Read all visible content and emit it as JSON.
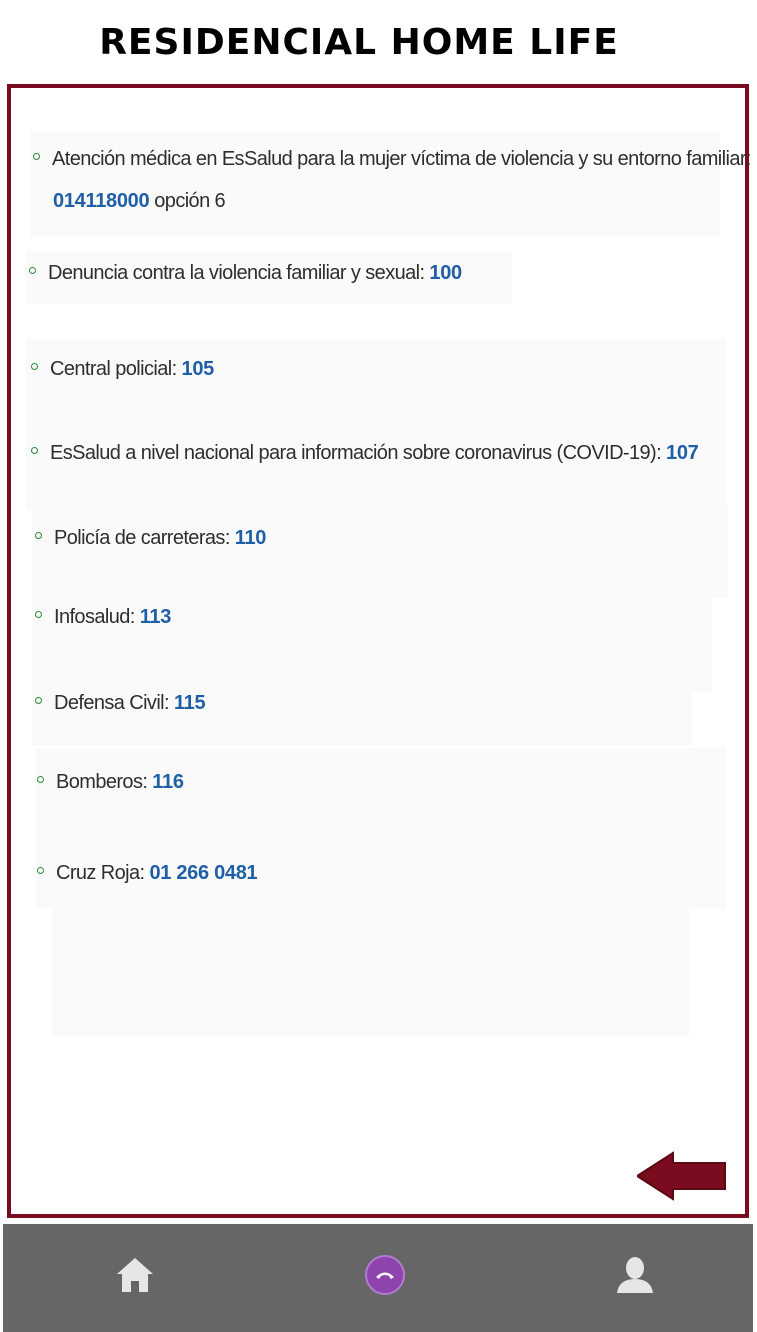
{
  "header": {
    "title": "RESIDENCIAL HOME LIFE"
  },
  "contacts": [
    {
      "label": "Atención médica en EsSalud para la mujer víctima de violencia y su entorno familiar:",
      "number": "014118000",
      "suffix": " opción 6"
    },
    {
      "label": "Denuncia contra la violencia familiar y sexual: ",
      "number": "100"
    },
    {
      "label": "Central policial: ",
      "number": "105"
    },
    {
      "label": "EsSalud a nivel nacional para información sobre coronavirus (COVID-19): ",
      "number": "107"
    },
    {
      "label": "Policía de carreteras: ",
      "number": "110"
    },
    {
      "label": "Infosalud: ",
      "number": "113"
    },
    {
      "label": "Defensa Civil: ",
      "number": "115"
    },
    {
      "label": "Bomberos: ",
      "number": "116"
    },
    {
      "label": "Cruz Roja: ",
      "number": "01 266 0481"
    }
  ],
  "icons": {
    "back": "arrow-left-icon",
    "home": "home-icon",
    "call": "phone-hangup-icon",
    "profile": "user-icon"
  },
  "colors": {
    "frame": "#7b0b1e",
    "number": "#1f5fa8",
    "bullet": "#2e8b3a",
    "nav_bg": "#666666",
    "call_button": "#8e44ad"
  }
}
